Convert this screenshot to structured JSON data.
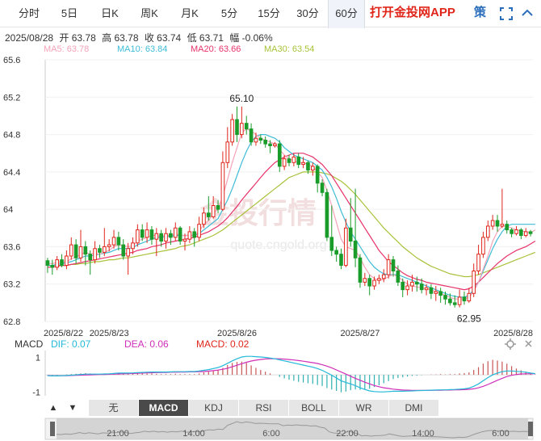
{
  "tabs": [
    "分时",
    "5日",
    "日K",
    "周K",
    "月K",
    "5分",
    "15分",
    "30分",
    "60分"
  ],
  "active_tab": "60分",
  "app_link": "打开金投网APP",
  "strategy_label": "策",
  "info": {
    "date": "2025/08/28",
    "open": "开 63.78",
    "high": "高 63.78",
    "close": "收 63.74",
    "low": "低 63.71",
    "change": "幅 -0.06%"
  },
  "ma": {
    "ma5": "MA5: 63.78",
    "ma10": "MA10: 63.84",
    "ma20": "MA20: 63.66",
    "ma30": "MA30: 63.54"
  },
  "colors": {
    "up": "#e0261b",
    "down": "#1a9c2a",
    "ma5": "#f4a3b8",
    "ma10": "#3fbcd6",
    "ma20": "#e8336b",
    "ma30": "#a8c23a",
    "dif": "#22b8d8",
    "dea": "#d02fb8",
    "macd_up": "#c85656",
    "macd_down": "#2fb0b0",
    "accent": "#e0261b",
    "link": "#2a6ebb"
  },
  "macd_info": {
    "name": "MACD",
    "dif": "DIF: 0.07",
    "dea": "DEA: 0.06",
    "macd": "MACD: 0.02"
  },
  "indicator_tabs": [
    "无",
    "MACD",
    "KDJ",
    "RSI",
    "BOLL",
    "WR",
    "DMI"
  ],
  "active_indicator": "MACD",
  "nav_arrows": [
    "▲",
    "▼"
  ],
  "navigator_labels": [
    "21:00",
    "14:00",
    "6:00",
    "22:00",
    "14:00",
    "6:00"
  ],
  "watermark": "金投行情",
  "watermark_url": "quote.cngold.org",
  "chart_data": {
    "type": "candlestick",
    "ylim": [
      62.8,
      65.6
    ],
    "yticks": [
      "65.6",
      "65.2",
      "64.8",
      "64.4",
      "64",
      "63.6",
      "63.2",
      "62.8"
    ],
    "ytick_values": [
      65.6,
      65.2,
      64.8,
      64.4,
      64.0,
      63.6,
      63.2,
      62.8
    ],
    "date_labels": [
      "2025/8/22",
      "2025/8/23",
      "2025/8/26",
      "2025/8/27",
      "2025/8/28"
    ],
    "date_label_bars": [
      0,
      13,
      40,
      66,
      103
    ],
    "annotations": [
      {
        "text": "65.10",
        "bar": 41,
        "value": 65.1,
        "kind": "high"
      },
      {
        "text": "62.95",
        "bar": 89,
        "value": 62.95,
        "kind": "low"
      }
    ],
    "candles": [
      [
        63.45,
        63.4,
        63.48,
        63.32
      ],
      [
        63.4,
        63.38,
        63.46,
        63.3
      ],
      [
        63.38,
        63.46,
        63.5,
        63.35
      ],
      [
        63.46,
        63.4,
        63.52,
        63.38
      ],
      [
        63.4,
        63.5,
        63.56,
        63.36
      ],
      [
        63.5,
        63.62,
        63.7,
        63.46
      ],
      [
        63.62,
        63.48,
        63.68,
        63.42
      ],
      [
        63.48,
        63.6,
        63.78,
        63.44
      ],
      [
        63.6,
        63.52,
        63.66,
        63.4
      ],
      [
        63.52,
        63.46,
        63.56,
        63.3
      ],
      [
        63.46,
        63.58,
        63.66,
        63.42
      ],
      [
        63.58,
        63.54,
        63.62,
        63.48
      ],
      [
        63.54,
        63.6,
        63.8,
        63.5
      ],
      [
        63.6,
        63.62,
        63.68,
        63.55
      ],
      [
        63.62,
        63.7,
        63.78,
        63.58
      ],
      [
        63.7,
        63.62,
        63.76,
        63.56
      ],
      [
        63.62,
        63.5,
        63.68,
        63.46
      ],
      [
        63.5,
        63.58,
        63.64,
        63.3
      ],
      [
        63.58,
        63.64,
        63.7,
        63.52
      ],
      [
        63.64,
        63.78,
        63.84,
        63.6
      ],
      [
        63.78,
        63.7,
        63.84,
        63.66
      ],
      [
        63.7,
        63.78,
        63.86,
        63.64
      ],
      [
        63.78,
        63.68,
        63.82,
        63.62
      ],
      [
        63.68,
        63.74,
        63.8,
        63.5
      ],
      [
        63.74,
        63.66,
        63.78,
        63.6
      ],
      [
        63.66,
        63.74,
        63.8,
        63.58
      ],
      [
        63.74,
        63.7,
        63.78,
        63.62
      ],
      [
        63.7,
        63.8,
        63.86,
        63.66
      ],
      [
        63.8,
        63.66,
        63.82,
        63.62
      ],
      [
        63.66,
        63.68,
        63.74,
        63.56
      ],
      [
        63.68,
        63.76,
        63.82,
        63.64
      ],
      [
        63.76,
        63.7,
        63.8,
        63.6
      ],
      [
        63.7,
        63.84,
        63.92,
        63.66
      ],
      [
        63.84,
        63.96,
        64.02,
        63.8
      ],
      [
        63.96,
        63.92,
        64.14,
        63.88
      ],
      [
        63.92,
        64.04,
        64.14,
        63.9
      ],
      [
        64.04,
        64.0,
        64.1,
        63.96
      ],
      [
        64.0,
        64.5,
        64.62,
        63.98
      ],
      [
        64.5,
        64.72,
        64.88,
        64.44
      ],
      [
        64.72,
        64.96,
        65.02,
        64.68
      ],
      [
        64.96,
        64.8,
        65.1,
        64.72
      ],
      [
        64.8,
        64.92,
        65.1,
        64.76
      ],
      [
        64.92,
        64.86,
        65.0,
        64.8
      ],
      [
        64.86,
        64.72,
        64.92,
        64.68
      ],
      [
        64.72,
        64.76,
        64.82,
        64.68
      ],
      [
        64.76,
        64.74,
        64.8,
        64.7
      ],
      [
        64.74,
        64.7,
        64.78,
        64.66
      ],
      [
        64.7,
        64.68,
        64.74,
        64.6
      ],
      [
        64.68,
        64.7,
        64.72,
        64.66
      ],
      [
        64.7,
        64.46,
        64.74,
        64.4
      ],
      [
        64.46,
        64.54,
        64.58,
        64.42
      ],
      [
        64.54,
        64.5,
        64.58,
        64.46
      ],
      [
        64.5,
        64.56,
        64.6,
        64.46
      ],
      [
        64.56,
        64.48,
        64.6,
        64.44
      ],
      [
        64.48,
        64.5,
        64.56,
        64.44
      ],
      [
        64.5,
        64.42,
        64.52,
        64.38
      ],
      [
        64.42,
        64.46,
        64.5,
        64.36
      ],
      [
        64.46,
        64.28,
        64.48,
        64.18
      ],
      [
        64.28,
        64.18,
        64.32,
        64.14
      ],
      [
        64.18,
        63.7,
        64.22,
        63.66
      ],
      [
        63.7,
        63.56,
        64.04,
        63.5
      ],
      [
        63.56,
        63.52,
        63.6,
        63.44
      ],
      [
        63.52,
        63.4,
        63.58,
        63.36
      ],
      [
        63.4,
        63.8,
        63.9,
        63.38
      ],
      [
        63.8,
        63.66,
        64.12,
        63.6
      ],
      [
        63.66,
        63.48,
        64.22,
        63.38
      ],
      [
        63.48,
        63.22,
        63.52,
        63.16
      ],
      [
        63.22,
        63.26,
        63.32,
        63.18
      ],
      [
        63.26,
        63.18,
        63.3,
        63.08
      ],
      [
        63.18,
        63.24,
        63.28,
        63.14
      ],
      [
        63.24,
        63.26,
        63.3,
        63.2
      ],
      [
        63.26,
        63.3,
        63.36,
        63.22
      ],
      [
        63.3,
        63.46,
        63.52,
        63.26
      ],
      [
        63.46,
        63.34,
        63.5,
        63.28
      ],
      [
        63.34,
        63.22,
        63.4,
        63.18
      ],
      [
        63.22,
        63.14,
        63.26,
        63.06
      ],
      [
        63.14,
        63.18,
        63.24,
        63.08
      ],
      [
        63.18,
        63.22,
        63.3,
        63.12
      ],
      [
        63.22,
        63.2,
        63.28,
        63.12
      ],
      [
        63.2,
        63.14,
        63.26,
        63.1
      ],
      [
        63.14,
        63.16,
        63.2,
        63.08
      ],
      [
        63.16,
        63.1,
        63.2,
        63.04
      ],
      [
        63.1,
        63.12,
        63.18,
        63.02
      ],
      [
        63.12,
        63.08,
        63.16,
        63.0
      ],
      [
        63.08,
        63.04,
        63.12,
        62.98
      ],
      [
        63.04,
        63.0,
        63.1,
        62.97
      ],
      [
        63.0,
        62.98,
        63.08,
        62.95
      ],
      [
        62.98,
        63.06,
        63.14,
        62.95
      ],
      [
        63.06,
        63.02,
        63.12,
        62.98
      ],
      [
        63.02,
        63.1,
        63.16,
        63.0
      ],
      [
        63.1,
        63.34,
        63.42,
        63.06
      ],
      [
        63.34,
        63.52,
        63.62,
        63.3
      ],
      [
        63.52,
        63.7,
        63.76,
        63.48
      ],
      [
        63.7,
        63.82,
        63.88,
        63.66
      ],
      [
        63.82,
        63.88,
        63.94,
        63.78
      ],
      [
        63.88,
        63.82,
        63.94,
        63.76
      ],
      [
        63.82,
        63.84,
        64.22,
        63.8
      ],
      [
        63.84,
        63.78,
        63.88,
        63.74
      ],
      [
        63.78,
        63.74,
        63.8,
        63.7
      ],
      [
        63.74,
        63.78,
        63.82,
        63.72
      ],
      [
        63.78,
        63.72,
        63.8,
        63.68
      ],
      [
        63.72,
        63.76,
        63.8,
        63.7
      ],
      [
        63.76,
        63.74,
        63.78,
        63.71
      ]
    ],
    "ma5": [
      63.42,
      63.42,
      63.43,
      63.44,
      63.44,
      63.47,
      63.49,
      63.52,
      63.54,
      63.52,
      63.53,
      63.52,
      63.54,
      63.56,
      63.6,
      63.62,
      63.61,
      63.6,
      63.61,
      63.66,
      63.68,
      63.7,
      63.72,
      63.72,
      63.71,
      63.72,
      63.72,
      63.74,
      63.72,
      63.72,
      63.72,
      63.72,
      63.76,
      63.84,
      63.88,
      63.96,
      64.0,
      64.14,
      64.32,
      64.5,
      64.66,
      64.82,
      64.86,
      64.84,
      64.8,
      64.76,
      64.74,
      64.72,
      64.7,
      64.64,
      64.58,
      64.54,
      64.52,
      64.5,
      64.5,
      64.48,
      64.46,
      64.4,
      64.34,
      64.2,
      64.04,
      63.86,
      63.68,
      63.6,
      63.58,
      63.56,
      63.48,
      63.38,
      63.3,
      63.26,
      63.24,
      63.25,
      63.28,
      63.3,
      63.28,
      63.24,
      63.2,
      63.18,
      63.17,
      63.16,
      63.15,
      63.14,
      63.12,
      63.1,
      63.08,
      63.06,
      63.04,
      63.04,
      63.04,
      63.06,
      63.12,
      63.22,
      63.36,
      63.5,
      63.66,
      63.76,
      63.82,
      63.82,
      63.8,
      63.78,
      63.77,
      63.76,
      63.75,
      63.78
    ],
    "ma10": [
      63.4,
      63.4,
      63.41,
      63.42,
      63.43,
      63.44,
      63.46,
      63.48,
      63.5,
      63.5,
      63.51,
      63.52,
      63.53,
      63.54,
      63.56,
      63.58,
      63.58,
      63.58,
      63.59,
      63.62,
      63.64,
      63.66,
      63.68,
      63.7,
      63.7,
      63.71,
      63.71,
      63.72,
      63.72,
      63.72,
      63.72,
      63.72,
      63.74,
      63.78,
      63.82,
      63.86,
      63.9,
      64.0,
      64.1,
      64.22,
      64.36,
      64.5,
      64.62,
      64.72,
      64.78,
      64.8,
      64.8,
      64.78,
      64.76,
      64.72,
      64.66,
      64.62,
      64.58,
      64.56,
      64.54,
      64.52,
      64.5,
      64.46,
      64.42,
      64.34,
      64.24,
      64.12,
      63.98,
      63.86,
      63.76,
      63.68,
      63.6,
      63.52,
      63.44,
      63.38,
      63.34,
      63.31,
      63.3,
      63.3,
      63.3,
      63.28,
      63.26,
      63.24,
      63.22,
      63.2,
      63.18,
      63.16,
      63.14,
      63.12,
      63.1,
      63.08,
      63.07,
      63.06,
      63.06,
      63.08,
      63.14,
      63.22,
      63.34,
      63.46,
      63.58,
      63.68,
      63.76,
      63.82,
      63.84,
      63.84,
      63.84,
      63.84,
      63.84,
      63.84
    ],
    "ma20": [
      63.38,
      63.38,
      63.39,
      63.4,
      63.4,
      63.41,
      63.42,
      63.43,
      63.44,
      63.45,
      63.46,
      63.47,
      63.48,
      63.49,
      63.5,
      63.51,
      63.52,
      63.53,
      63.54,
      63.56,
      63.57,
      63.58,
      63.6,
      63.61,
      63.62,
      63.64,
      63.65,
      63.66,
      63.67,
      63.68,
      63.69,
      63.7,
      63.72,
      63.74,
      63.76,
      63.79,
      63.82,
      63.86,
      63.91,
      63.97,
      64.03,
      64.1,
      64.16,
      64.22,
      64.28,
      64.34,
      64.4,
      64.45,
      64.5,
      64.53,
      64.56,
      64.58,
      64.6,
      64.6,
      64.6,
      64.58,
      64.56,
      64.52,
      64.48,
      64.42,
      64.36,
      64.28,
      64.2,
      64.12,
      64.04,
      63.96,
      63.88,
      63.8,
      63.72,
      63.64,
      63.56,
      63.5,
      63.44,
      63.4,
      63.36,
      63.32,
      63.29,
      63.27,
      63.25,
      63.24,
      63.22,
      63.21,
      63.2,
      63.19,
      63.18,
      63.17,
      63.16,
      63.15,
      63.14,
      63.15,
      63.18,
      63.22,
      63.27,
      63.32,
      63.37,
      63.42,
      63.46,
      63.5,
      63.53,
      63.56,
      63.58,
      63.6,
      63.63,
      63.66
    ],
    "ma30": [
      63.4,
      63.4,
      63.4,
      63.4,
      63.4,
      63.41,
      63.41,
      63.42,
      63.42,
      63.43,
      63.44,
      63.44,
      63.45,
      63.46,
      63.46,
      63.47,
      63.48,
      63.48,
      63.49,
      63.5,
      63.51,
      63.52,
      63.53,
      63.54,
      63.55,
      63.56,
      63.57,
      63.58,
      63.6,
      63.61,
      63.62,
      63.64,
      63.66,
      63.68,
      63.7,
      63.72,
      63.75,
      63.78,
      63.82,
      63.86,
      63.9,
      63.94,
      63.98,
      64.02,
      64.06,
      64.1,
      64.14,
      64.18,
      64.22,
      64.26,
      64.3,
      64.34,
      64.36,
      64.38,
      64.4,
      64.4,
      64.4,
      64.4,
      64.39,
      64.38,
      64.36,
      64.33,
      64.3,
      64.26,
      64.21,
      64.16,
      64.1,
      64.04,
      63.98,
      63.92,
      63.86,
      63.8,
      63.75,
      63.7,
      63.65,
      63.6,
      63.56,
      63.52,
      63.48,
      63.45,
      63.42,
      63.39,
      63.37,
      63.35,
      63.33,
      63.31,
      63.3,
      63.29,
      63.28,
      63.28,
      63.29,
      63.3,
      63.32,
      63.34,
      63.36,
      63.38,
      63.4,
      63.42,
      63.44,
      63.46,
      63.48,
      63.5,
      63.52,
      63.54
    ],
    "macd": {
      "ylim": [
        -1.2,
        1.3
      ],
      "yticks": [
        "1",
        "-1"
      ],
      "ytick_values": [
        1,
        -1
      ],
      "dif": [
        -0.05,
        -0.06,
        -0.06,
        -0.05,
        -0.04,
        -0.02,
        0.0,
        0.02,
        0.04,
        0.04,
        0.04,
        0.04,
        0.05,
        0.06,
        0.08,
        0.1,
        0.1,
        0.1,
        0.11,
        0.13,
        0.14,
        0.15,
        0.16,
        0.16,
        0.16,
        0.16,
        0.17,
        0.18,
        0.18,
        0.18,
        0.19,
        0.19,
        0.22,
        0.26,
        0.3,
        0.36,
        0.42,
        0.52,
        0.66,
        0.8,
        0.92,
        1.02,
        1.06,
        1.06,
        1.04,
        1.02,
        1.0,
        0.96,
        0.92,
        0.86,
        0.8,
        0.74,
        0.68,
        0.62,
        0.56,
        0.5,
        0.44,
        0.36,
        0.26,
        0.12,
        -0.02,
        -0.18,
        -0.34,
        -0.44,
        -0.52,
        -0.62,
        -0.74,
        -0.84,
        -0.92,
        -0.96,
        -0.98,
        -0.98,
        -0.96,
        -0.94,
        -0.94,
        -0.94,
        -0.93,
        -0.92,
        -0.91,
        -0.9,
        -0.89,
        -0.88,
        -0.87,
        -0.86,
        -0.86,
        -0.85,
        -0.84,
        -0.82,
        -0.8,
        -0.76,
        -0.66,
        -0.52,
        -0.34,
        -0.16,
        0.0,
        0.1,
        0.18,
        0.22,
        0.22,
        0.2,
        0.18,
        0.15,
        0.1,
        0.07
      ],
      "dea": [
        -0.04,
        -0.05,
        -0.05,
        -0.05,
        -0.05,
        -0.04,
        -0.03,
        -0.02,
        -0.01,
        0.0,
        0.01,
        0.02,
        0.02,
        0.03,
        0.04,
        0.05,
        0.06,
        0.07,
        0.08,
        0.09,
        0.1,
        0.11,
        0.12,
        0.13,
        0.14,
        0.14,
        0.15,
        0.15,
        0.16,
        0.16,
        0.17,
        0.17,
        0.18,
        0.19,
        0.21,
        0.24,
        0.27,
        0.32,
        0.38,
        0.46,
        0.55,
        0.64,
        0.72,
        0.79,
        0.84,
        0.88,
        0.91,
        0.92,
        0.92,
        0.92,
        0.9,
        0.88,
        0.85,
        0.82,
        0.78,
        0.74,
        0.7,
        0.65,
        0.58,
        0.5,
        0.4,
        0.28,
        0.16,
        0.04,
        -0.08,
        -0.2,
        -0.31,
        -0.42,
        -0.52,
        -0.61,
        -0.68,
        -0.74,
        -0.78,
        -0.82,
        -0.85,
        -0.87,
        -0.88,
        -0.89,
        -0.89,
        -0.89,
        -0.89,
        -0.89,
        -0.88,
        -0.88,
        -0.87,
        -0.87,
        -0.86,
        -0.86,
        -0.85,
        -0.83,
        -0.8,
        -0.74,
        -0.66,
        -0.55,
        -0.43,
        -0.31,
        -0.2,
        -0.1,
        -0.03,
        0.02,
        0.05,
        0.06,
        0.06,
        0.06
      ]
    }
  }
}
